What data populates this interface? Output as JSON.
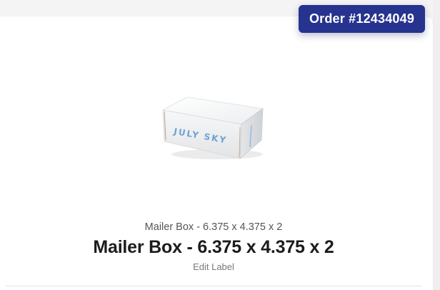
{
  "order": {
    "label": "Order #12434049",
    "badge_color": "#26338f"
  },
  "product": {
    "image_icon": "mailer-box-image",
    "box_print_text": "JULY SKY",
    "subtitle": "Mailer Box - 6.375 x 4.375 x 2",
    "title": "Mailer Box - 6.375 x 4.375 x 2",
    "edit_label": "Edit Label"
  }
}
